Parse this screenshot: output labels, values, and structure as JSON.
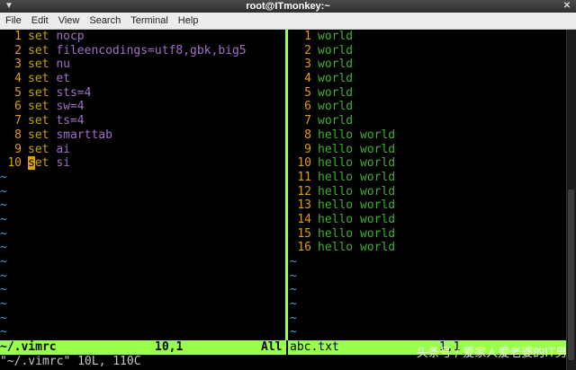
{
  "window": {
    "title": "root@ITmonkey:~"
  },
  "menu": [
    "File",
    "Edit",
    "View",
    "Search",
    "Terminal",
    "Help"
  ],
  "left": {
    "lines": [
      {
        "n": "1",
        "kw": "set",
        "opt": "nocp"
      },
      {
        "n": "2",
        "kw": "set",
        "opt": "fileencodings=utf8,gbk,big5"
      },
      {
        "n": "3",
        "kw": "set",
        "opt": "nu"
      },
      {
        "n": "4",
        "kw": "set",
        "opt": "et"
      },
      {
        "n": "5",
        "kw": "set",
        "opt": "sts=4"
      },
      {
        "n": "6",
        "kw": "set",
        "opt": "sw=4"
      },
      {
        "n": "7",
        "kw": "set",
        "opt": "ts=4"
      },
      {
        "n": "8",
        "kw": "set",
        "opt": "smarttab"
      },
      {
        "n": "9",
        "kw": "set",
        "opt": "ai"
      },
      {
        "n": "10",
        "kw": "set",
        "opt": "si",
        "cursor": true
      }
    ],
    "tilde": "~"
  },
  "right": {
    "lines": [
      {
        "n": "1",
        "t": "world"
      },
      {
        "n": "2",
        "t": "world"
      },
      {
        "n": "3",
        "t": "world"
      },
      {
        "n": "4",
        "t": "world"
      },
      {
        "n": "5",
        "t": "world"
      },
      {
        "n": "6",
        "t": "world"
      },
      {
        "n": "7",
        "t": "world"
      },
      {
        "n": "8",
        "t": "hello world"
      },
      {
        "n": "9",
        "t": "hello world"
      },
      {
        "n": "10",
        "t": "hello world"
      },
      {
        "n": "11",
        "t": "hello world"
      },
      {
        "n": "12",
        "t": "hello world"
      },
      {
        "n": "13",
        "t": "hello world"
      },
      {
        "n": "14",
        "t": "hello world"
      },
      {
        "n": "15",
        "t": "hello world"
      },
      {
        "n": "16",
        "t": "hello world"
      }
    ]
  },
  "status": {
    "left_file": "~/.vimrc",
    "left_pos": "10,1",
    "left_pct": "All",
    "right_file": "abc.txt",
    "right_pos": "1,1"
  },
  "cmdline": "\"~/.vimrc\" 10L, 110C",
  "watermark": "头条号 / 爱家人爱老婆的IT男",
  "colors": {
    "accent": "#9aff4a",
    "line_number": "#e0a000",
    "keyword": "#c8a200",
    "option": "#a070c8",
    "text": "#40b030",
    "tilde": "#4aa0d8"
  }
}
